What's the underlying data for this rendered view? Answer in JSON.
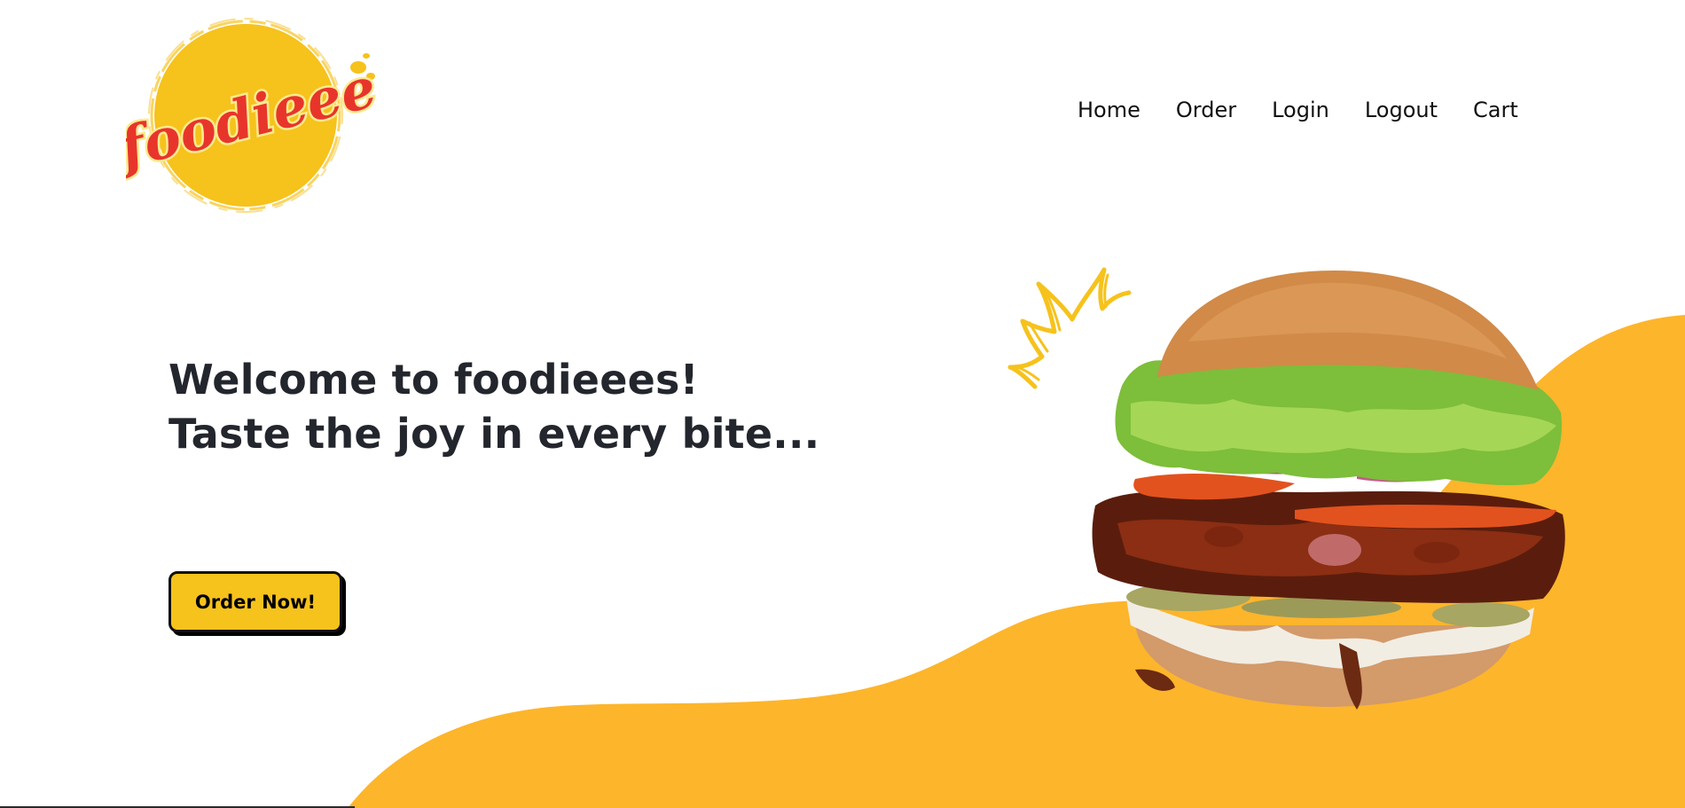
{
  "brand": {
    "logo_text": "foodieee",
    "logo_colors": {
      "circle": "#F6C21C",
      "text": "#E8352B"
    }
  },
  "nav": {
    "items": [
      {
        "label": "Home"
      },
      {
        "label": "Order"
      },
      {
        "label": "Login"
      },
      {
        "label": "Logout"
      },
      {
        "label": "Cart"
      }
    ]
  },
  "hero": {
    "line1": "Welcome to foodieees!",
    "line2": "Taste the joy in every bite...",
    "cta_label": "Order Now!"
  },
  "theme": {
    "accent": "#FDB52B",
    "button_bg": "#F6C21C",
    "text": "#23262D"
  },
  "icons": {
    "hero_image": "burger-image",
    "decoration": "crown-sketch-icon"
  }
}
